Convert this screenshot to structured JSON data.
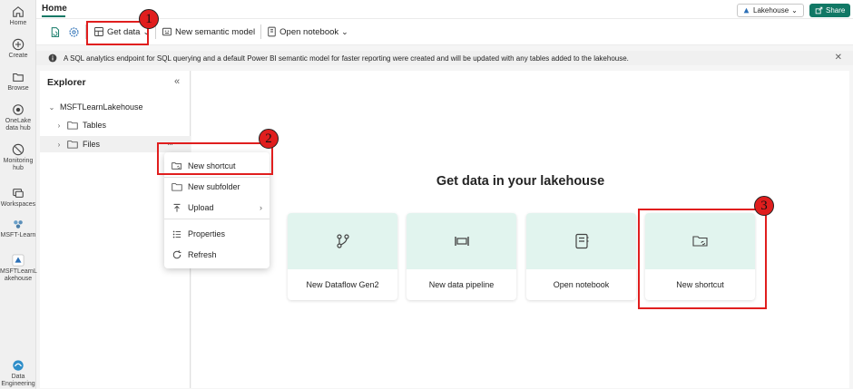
{
  "rail": {
    "items": [
      {
        "label": "Home",
        "icon": "home-icon"
      },
      {
        "label": "Create",
        "icon": "create-icon"
      },
      {
        "label": "Browse",
        "icon": "browse-icon"
      },
      {
        "label": "OneLake\ndata hub",
        "icon": "onelake-icon"
      },
      {
        "label": "Monitoring\nhub",
        "icon": "monitoring-icon"
      },
      {
        "label": "Workspaces",
        "icon": "workspaces-icon"
      },
      {
        "label": "MSFT-Learn",
        "icon": "workspace-icon"
      },
      {
        "label": "MSFTLearnL\nakehouse",
        "icon": "lakehouse-icon"
      },
      {
        "label": "Data\nEngineering",
        "icon": "data-engineering-icon"
      }
    ]
  },
  "header": {
    "tab": "Home",
    "lakehouse_label": "Lakehouse",
    "share_label": "Share"
  },
  "toolbar": {
    "get_data": "Get data",
    "new_semantic_model": "New semantic model",
    "open_notebook": "Open notebook"
  },
  "infobar": {
    "message": "A SQL analytics endpoint for SQL querying and a default Power BI semantic model for faster reporting were created and will be updated with any tables added to the lakehouse.",
    "close": "✕"
  },
  "explorer": {
    "title": "Explorer",
    "collapse": "«",
    "root": "MSFTLearnLakehouse",
    "tables": "Tables",
    "files": "Files",
    "more": "···"
  },
  "menu": {
    "items": [
      "New shortcut",
      "New subfolder",
      "Upload",
      "Properties",
      "Refresh"
    ]
  },
  "main": {
    "title": "Get data in your lakehouse",
    "cards": [
      "New Dataflow Gen2",
      "New data pipeline",
      "Open notebook",
      "New shortcut"
    ]
  },
  "callouts": [
    "1",
    "2",
    "3"
  ],
  "colors": {
    "accent": "#117865",
    "callout": "#e01e1e",
    "card_bg": "#e1f4ee"
  }
}
